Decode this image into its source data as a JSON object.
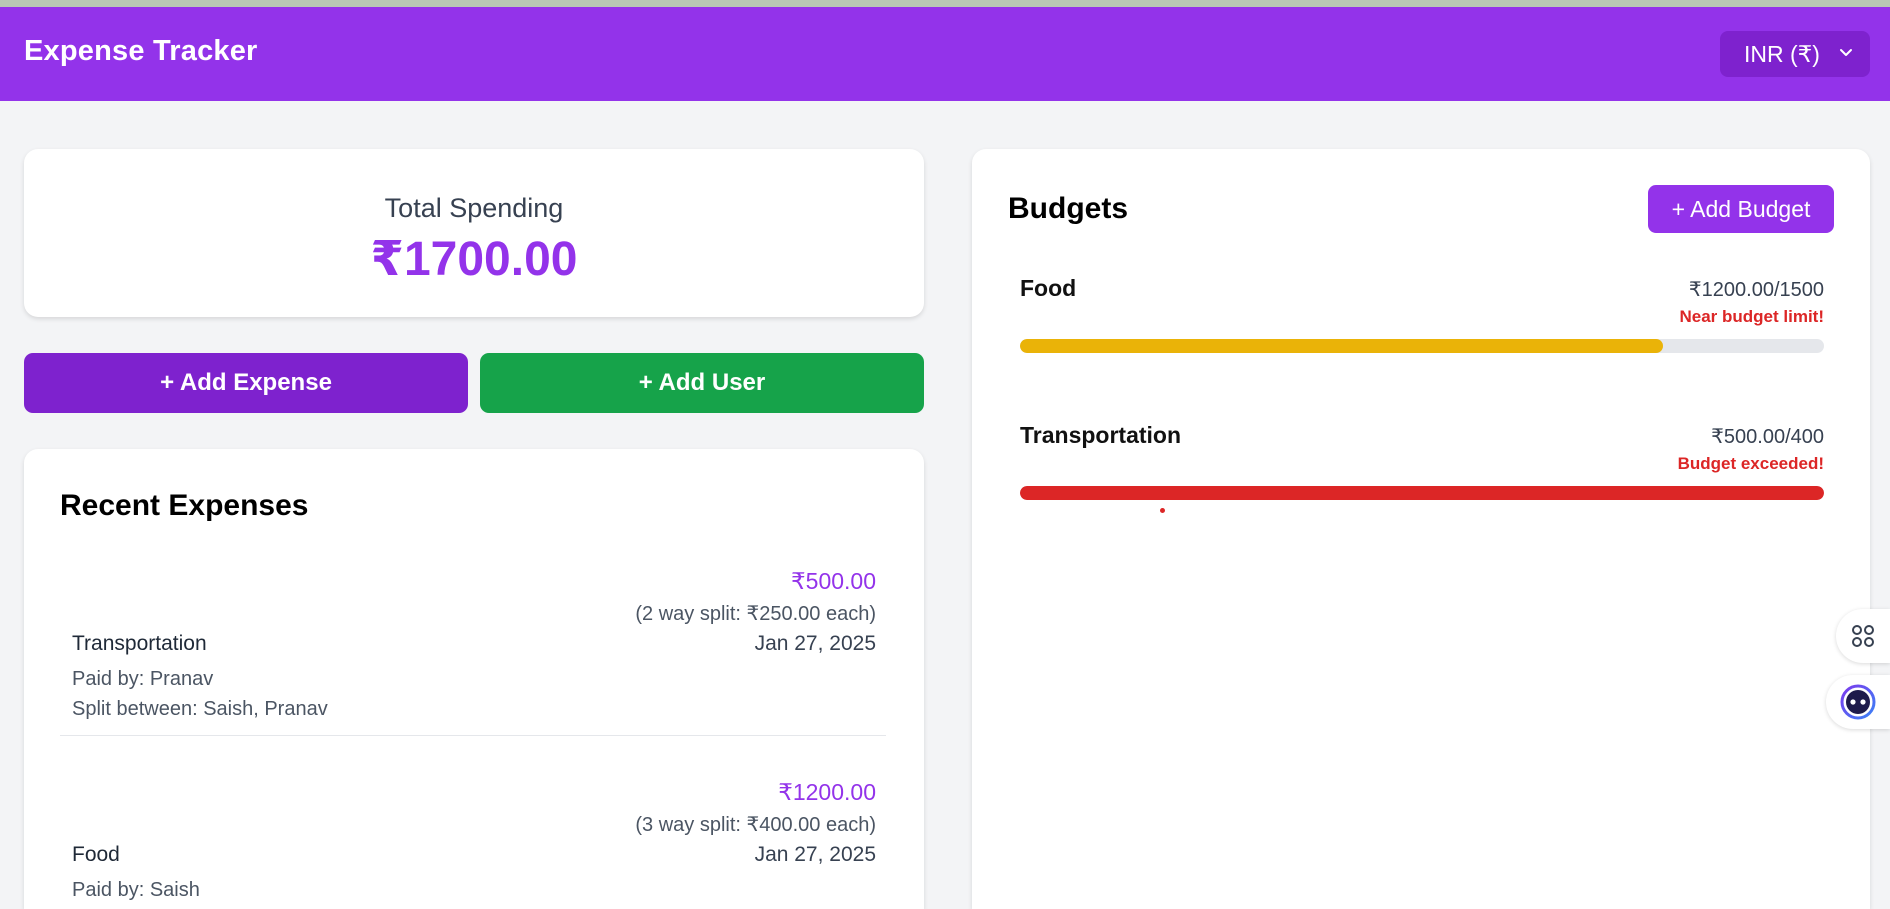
{
  "app": {
    "title": "Expense Tracker"
  },
  "currency": {
    "selected": "INR (₹)"
  },
  "summary": {
    "label": "Total Spending",
    "value": "₹1700.00"
  },
  "actions": {
    "add_expense": "+ Add Expense",
    "add_user": "+ Add User"
  },
  "expenses": {
    "heading": "Recent Expenses",
    "items": [
      {
        "amount": "₹500.00",
        "split": "(2 way split: ₹250.00 each)",
        "category": "Transportation",
        "date": "Jan 27, 2025",
        "paid_by": "Paid by: Pranav",
        "split_between": "Split between: Saish, Pranav"
      },
      {
        "amount": "₹1200.00",
        "split": "(3 way split: ₹400.00 each)",
        "category": "Food",
        "date": "Jan 27, 2025",
        "paid_by": "Paid by: Saish"
      }
    ]
  },
  "budgets": {
    "heading": "Budgets",
    "add_button": "+ Add Budget",
    "items": [
      {
        "name": "Food",
        "amount": "₹1200.00/1500",
        "status": "Near budget limit!",
        "progress": 0.8,
        "bar_color": "#eab308"
      },
      {
        "name": "Transportation",
        "amount": "₹500.00/400",
        "status": "Budget exceeded!",
        "progress": 1.0,
        "bar_color": "#dc2626"
      }
    ]
  },
  "colors": {
    "brand": "#9333ea",
    "brand_dark": "#7e22ce",
    "success": "#16a34a",
    "warning": "#eab308",
    "danger": "#dc2626"
  },
  "icons": {
    "currency_dropdown": "chevron-down-icon",
    "float_top": "command-icon",
    "float_bottom": "assistant-face-icon"
  }
}
